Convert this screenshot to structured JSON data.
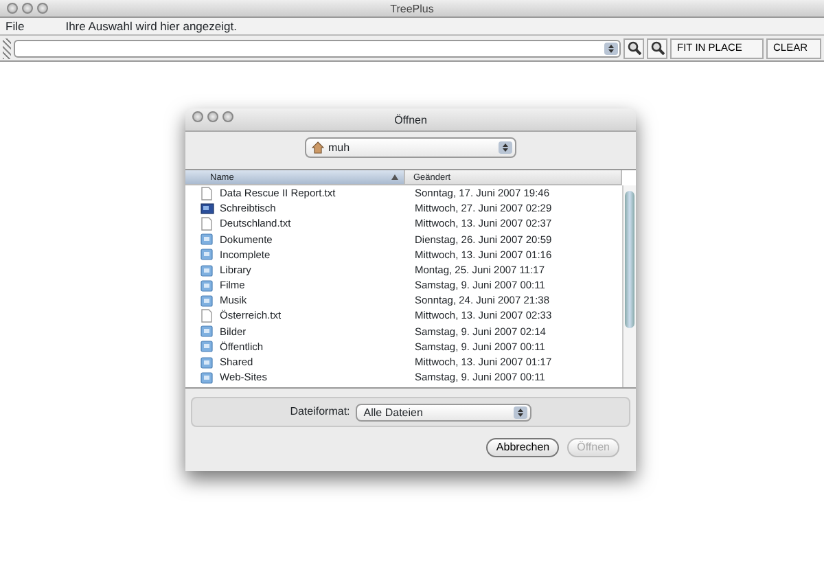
{
  "window": {
    "title": "TreePlus"
  },
  "menu": [
    {
      "label": "File"
    }
  ],
  "selection_text": "Ihre Auswahl wird hier angezeigt.",
  "toolbar": {
    "buttons": [
      {
        "label": "FIT IN PLACE"
      },
      {
        "label": "CLEAR"
      }
    ]
  },
  "dialog": {
    "title": "Öffnen",
    "location": "muh",
    "columns": [
      {
        "label": "Name",
        "sorted": true
      },
      {
        "label": "Geändert",
        "sorted": false
      }
    ],
    "rows": [
      {
        "name": "Data Rescue II Report.txt",
        "modified": "Sonntag, 17. Juni 2007 19:46",
        "kind": "file"
      },
      {
        "name": "Schreibtisch",
        "modified": "Mittwoch, 27. Juni 2007 02:29",
        "kind": "desktop"
      },
      {
        "name": "Deutschland.txt",
        "modified": "Mittwoch, 13. Juni 2007 02:37",
        "kind": "file"
      },
      {
        "name": "Dokumente",
        "modified": "Dienstag, 26. Juni 2007 20:59",
        "kind": "folder"
      },
      {
        "name": "Incomplete",
        "modified": "Mittwoch, 13. Juni 2007 01:16",
        "kind": "folder"
      },
      {
        "name": "Library",
        "modified": "Montag, 25. Juni 2007 11:17",
        "kind": "folder"
      },
      {
        "name": "Filme",
        "modified": "Samstag, 9. Juni 2007 00:11",
        "kind": "folder"
      },
      {
        "name": "Musik",
        "modified": "Sonntag, 24. Juni 2007 21:38",
        "kind": "folder"
      },
      {
        "name": "Österreich.txt",
        "modified": "Mittwoch, 13. Juni 2007 02:33",
        "kind": "file"
      },
      {
        "name": "Bilder",
        "modified": "Samstag, 9. Juni 2007 02:14",
        "kind": "folder"
      },
      {
        "name": "Öffentlich",
        "modified": "Samstag, 9. Juni 2007 00:11",
        "kind": "folder"
      },
      {
        "name": "Shared",
        "modified": "Mittwoch, 13. Juni 2007 01:17",
        "kind": "folder"
      },
      {
        "name": "Web-Sites",
        "modified": "Samstag, 9. Juni 2007 00:11",
        "kind": "folder"
      }
    ],
    "format_label": "Dateiformat:",
    "format_value": "Alle Dateien",
    "buttons": [
      {
        "label": "Abbrechen",
        "disabled": false
      },
      {
        "label": "Öffnen",
        "disabled": true
      }
    ]
  }
}
